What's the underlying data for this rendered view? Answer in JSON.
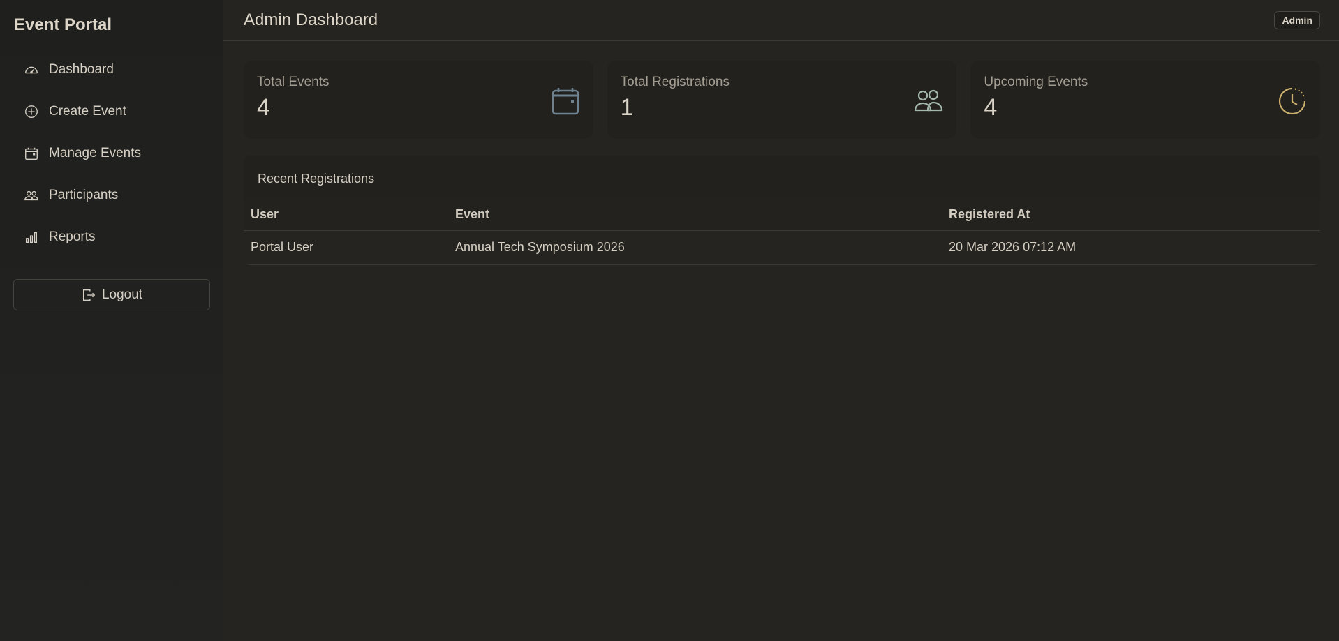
{
  "app": {
    "brand": "Event Portal"
  },
  "sidebar": {
    "items": [
      {
        "label": "Dashboard",
        "icon": "speedometer-icon"
      },
      {
        "label": "Create Event",
        "icon": "plus-circle-icon"
      },
      {
        "label": "Manage Events",
        "icon": "calendar-icon"
      },
      {
        "label": "Participants",
        "icon": "people-icon"
      },
      {
        "label": "Reports",
        "icon": "bar-chart-icon"
      }
    ],
    "logout_label": "Logout"
  },
  "header": {
    "title": "Admin Dashboard",
    "role_badge": "Admin"
  },
  "stats": [
    {
      "label": "Total Events",
      "value": "4",
      "icon": "calendar-icon",
      "color": "#6f8290"
    },
    {
      "label": "Total Registrations",
      "value": "1",
      "icon": "people-icon",
      "color": "#a3b7aa"
    },
    {
      "label": "Upcoming Events",
      "value": "4",
      "icon": "clock-icon",
      "color": "#cbb06d"
    }
  ],
  "recent_registrations": {
    "title": "Recent Registrations",
    "columns": [
      "User",
      "Event",
      "Registered At"
    ],
    "rows": [
      [
        "Portal User",
        "Annual Tech Symposium 2026",
        "20 Mar 2026 07:12 AM"
      ]
    ]
  }
}
